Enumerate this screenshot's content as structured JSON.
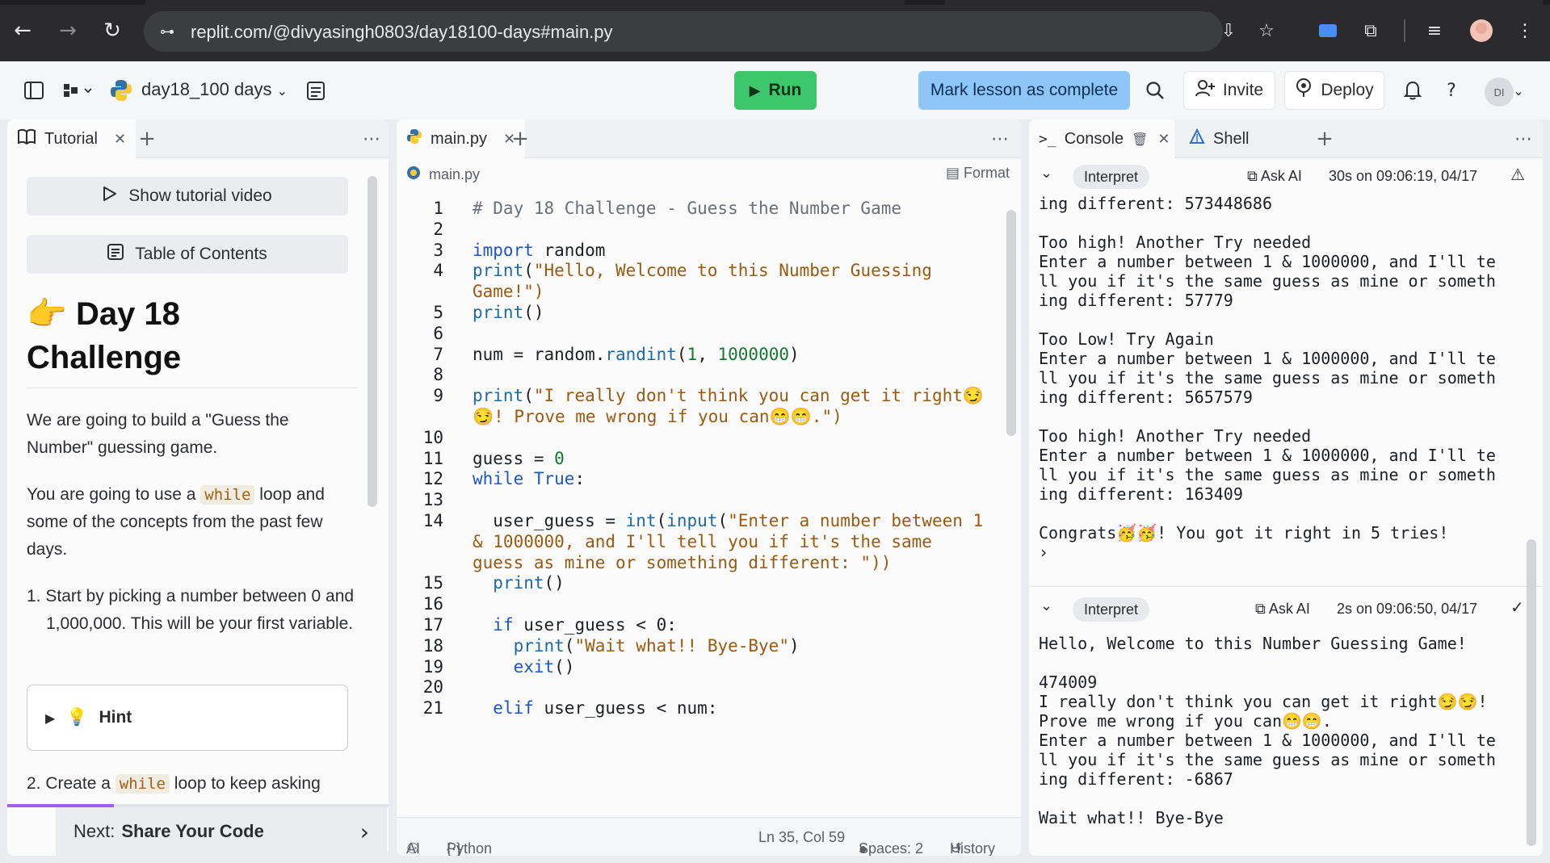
{
  "browser": {
    "url": "replit.com/@divyasingh0803/day18100-days#main.py",
    "back_icon": "←",
    "forward_icon": "→",
    "reload_icon": "↻",
    "site_icon": "⊶",
    "install_icon": "⇩",
    "star_icon": "☆",
    "ext_icon": "⧉",
    "media_icon": "≡",
    "menu_icon": "⋮"
  },
  "header": {
    "repl_name": "day18_100 days",
    "run_label": "Run",
    "mark_complete_label": "Mark lesson as complete",
    "invite_label": "Invite",
    "deploy_label": "Deploy",
    "avatar_initials": "DI"
  },
  "tutorial": {
    "tab_label": "Tutorial",
    "show_video_label": "Show tutorial video",
    "toc_label": "Table of Contents",
    "title_emoji": "👉",
    "title_line1": "Day 18",
    "title_line2": "Challenge",
    "para1": "We are going to build a \"Guess the Number\" guessing game.",
    "para2_a": "You are going to use a",
    "para2_code": "while",
    "para2_b": "loop and some of the concepts from the past few days.",
    "step1": "1. Start by picking a number between 0 and 1,000,000. This will be your first variable.",
    "hint_label": "Hint",
    "step2_a": "2. Create a",
    "step2_code": "while",
    "step2_b": "loop to keep asking",
    "next_prefix": "Next:",
    "next_title": "Share Your Code",
    "progress": 0.28
  },
  "editor": {
    "tab_label": "main.py",
    "crumb": "main.py",
    "format_label": "Format",
    "status": {
      "ai": "AI",
      "lang": "Python",
      "position": "Ln 35, Col 59",
      "spaces": "Spaces: 2",
      "history": "History"
    },
    "lines": [
      {
        "n": "1",
        "t": "# Day 18 Challenge - Guess the Number Game",
        "c": "cm"
      },
      {
        "n": "2",
        "t": "",
        "c": ""
      },
      {
        "n": "3",
        "t": "import random",
        "c": "kw1"
      },
      {
        "n": "4",
        "t": "print(\"Hello, Welcome to this Number Guessing",
        "c": "p"
      },
      {
        "n": "",
        "t": "Game!\")",
        "c": "s"
      },
      {
        "n": "5",
        "t": "print()",
        "c": ""
      },
      {
        "n": "6",
        "t": "",
        "c": ""
      },
      {
        "n": "7",
        "t": "num = random.randint(1, 1000000)",
        "c": ""
      },
      {
        "n": "8",
        "t": "",
        "c": ""
      },
      {
        "n": "9",
        "t": "print(\"I really don't think you can get it right😏",
        "c": "p"
      },
      {
        "n": "",
        "t": "😏! Prove me wrong if you can😁😁.\")",
        "c": "s"
      },
      {
        "n": "10",
        "t": "",
        "c": ""
      },
      {
        "n": "11",
        "t": "guess = 0",
        "c": ""
      },
      {
        "n": "12",
        "t": "while True:",
        "c": "kw1"
      },
      {
        "n": "13",
        "t": "",
        "c": ""
      },
      {
        "n": "14",
        "t": "  user_guess = int(input(\"Enter a number between 1",
        "c": ""
      },
      {
        "n": "",
        "t": "& 1000000, and I'll tell you if it's the same",
        "c": "s"
      },
      {
        "n": "",
        "t": "guess as mine or something different: \"))",
        "c": "s"
      },
      {
        "n": "15",
        "t": "  print()",
        "c": ""
      },
      {
        "n": "16",
        "t": "",
        "c": ""
      },
      {
        "n": "17",
        "t": "  if user_guess < 0:",
        "c": ""
      },
      {
        "n": "18",
        "t": "    print(\"Wait what!! Bye-Bye\")",
        "c": ""
      },
      {
        "n": "19",
        "t": "    exit()",
        "c": ""
      },
      {
        "n": "20",
        "t": "",
        "c": ""
      },
      {
        "n": "21",
        "t": "  elif user_guess < num:",
        "c": ""
      }
    ]
  },
  "console": {
    "tab_label": "Console",
    "shell_label": "Shell",
    "run1": {
      "interpret": "Interpret",
      "ask_ai": "Ask AI",
      "time": "30s on 09:06:19, 04/17",
      "status_icon": "⚠"
    },
    "run1_output": "ing different: 573448686\n\nToo high! Another Try needed\nEnter a number between 1 & 1000000, and I'll te\nll you if it's the same guess as mine or someth\ning different: 57779\n\nToo Low! Try Again\nEnter a number between 1 & 1000000, and I'll te\nll you if it's the same guess as mine or someth\ning different: 5657579\n\nToo high! Another Try needed\nEnter a number between 1 & 1000000, and I'll te\nll you if it's the same guess as mine or someth\ning different: 163409\n\nCongrats🥳🥳! You got it right in 5 tries!\n›",
    "run2": {
      "interpret": "Interpret",
      "ask_ai": "Ask AI",
      "time": "2s on 09:06:50, 04/17",
      "status_icon": "✓"
    },
    "run2_output": "Hello, Welcome to this Number Guessing Game!\n\n474009\nI really don't think you can get it right😏😏!\nProve me wrong if you can😁😁.\nEnter a number between 1 & 1000000, and I'll te\nll you if it's the same guess as mine or someth\ning different: -6867\n\nWait what!! Bye-Bye"
  }
}
